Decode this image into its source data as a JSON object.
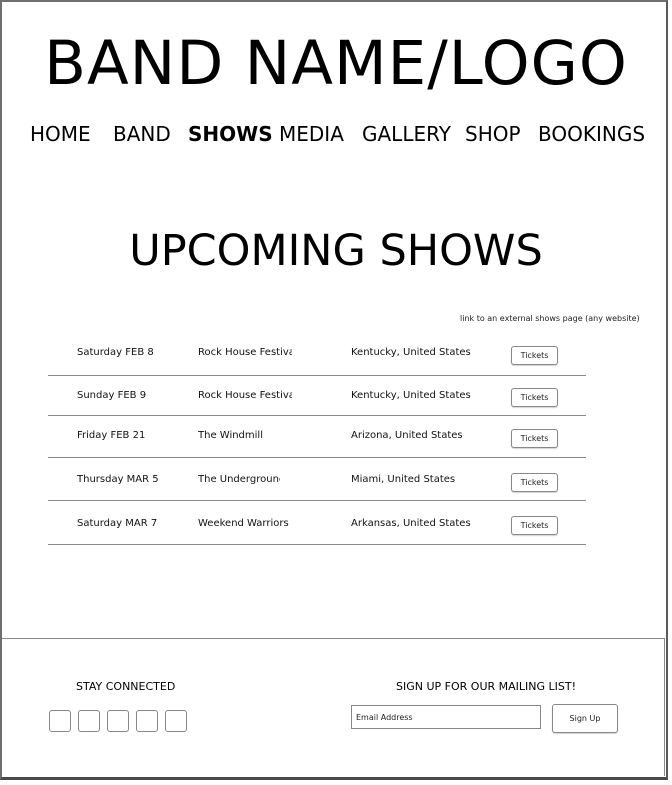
{
  "header": {
    "logo": "BAND NAME/LOGO"
  },
  "nav": {
    "items": [
      {
        "label": "HOME",
        "active": false
      },
      {
        "label": "BAND",
        "active": false
      },
      {
        "label": "SHOWS",
        "active": true
      },
      {
        "label": "MEDIA",
        "active": false
      },
      {
        "label": "GALLERY",
        "active": false
      },
      {
        "label": "SHOP",
        "active": false
      },
      {
        "label": "BOOKINGS",
        "active": false
      }
    ]
  },
  "main": {
    "heading": "UPCOMING SHOWS",
    "external_link": "link to an external shows page (any website)",
    "shows": [
      {
        "date": "Saturday FEB 8",
        "venue": "Rock House Festival",
        "location": "Kentucky, United States",
        "ticket_label": "Tickets"
      },
      {
        "date": "Sunday FEB 9",
        "venue": "Rock House Festival",
        "location": "Kentucky, United States",
        "ticket_label": "Tickets"
      },
      {
        "date": "Friday FEB 21",
        "venue": "The Windmill",
        "location": "Arizona, United States",
        "ticket_label": "Tickets"
      },
      {
        "date": "Thursday MAR 5",
        "venue": "The Undergrounc",
        "location": "Miami, United States",
        "ticket_label": "Tickets"
      },
      {
        "date": "Saturday MAR 7",
        "venue": "Weekend Warriors",
        "location": "Arkansas, United States",
        "ticket_label": "Tickets"
      }
    ]
  },
  "footer": {
    "stay_connected": "STAY CONNECTED",
    "mailing_list": "SIGN UP FOR OUR MAILING LIST!",
    "email_placeholder": "Email Address",
    "signup_label": "Sign Up",
    "social_icons": [
      "social-icon-1",
      "social-icon-2",
      "social-icon-3",
      "social-icon-4",
      "social-icon-5"
    ]
  }
}
